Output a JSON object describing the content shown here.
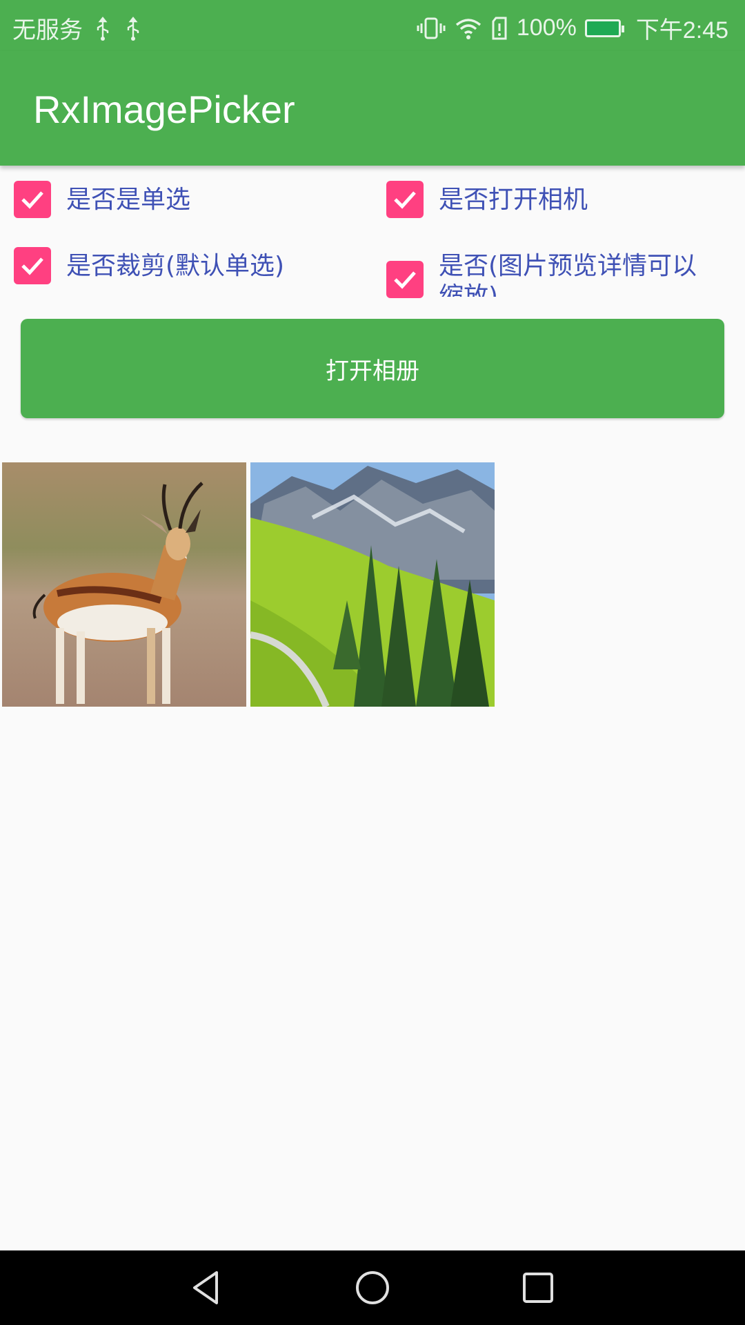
{
  "status_bar": {
    "carrier": "无服务",
    "battery_percent": "100%",
    "time": "下午2:45",
    "icons": [
      "usb-icon",
      "usb-icon",
      "vibrate-icon",
      "wifi-icon",
      "sim-alert-icon",
      "battery-charging-icon"
    ]
  },
  "app_bar": {
    "title": "RxImagePicker"
  },
  "options": [
    {
      "label": "是否是单选",
      "checked": true
    },
    {
      "label": "是否打开相机",
      "checked": true
    },
    {
      "label": "是否裁剪(默认单选)",
      "checked": true
    },
    {
      "label": "是否(图片预览详情可以缩放)",
      "checked": true
    }
  ],
  "open_album_button": {
    "label": "打开相册"
  },
  "images": [
    {
      "subject": "gazelle"
    },
    {
      "subject": "mountain-landscape"
    }
  ],
  "nav_bar": {
    "buttons": [
      "back",
      "home",
      "recents"
    ]
  },
  "colors": {
    "primary": "#4caf50",
    "accent": "#ff4081",
    "label_text": "#3f51b5",
    "background": "#fafafa"
  }
}
